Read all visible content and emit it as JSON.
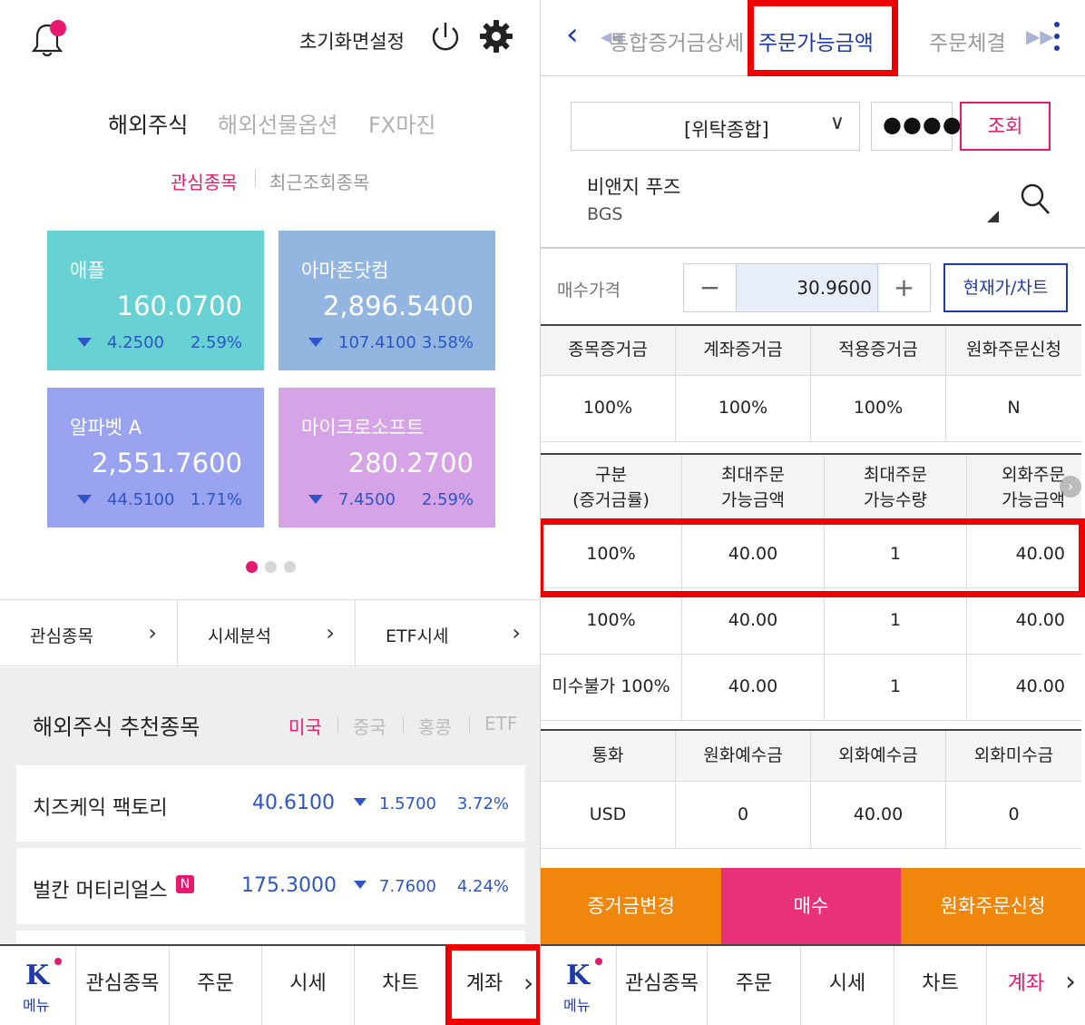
{
  "left": {
    "header": {
      "reset_label": "초기화면설정"
    },
    "market_tabs": [
      "해외주식",
      "해외선물옵션",
      "FX마진"
    ],
    "sub_tabs": [
      "관심종목",
      "최근조회종목"
    ],
    "cards": [
      {
        "name": "애플",
        "price": "160.0700",
        "change": "4.2500",
        "percent": "2.59%",
        "color": "#67d1d3"
      },
      {
        "name": "아마존닷컴",
        "price": "2,896.5400",
        "change": "107.4100",
        "percent": "3.58%",
        "color": "#93b6e1"
      },
      {
        "name": "알파벳 A",
        "price": "2,551.7600",
        "change": "44.5100",
        "percent": "1.71%",
        "color": "#9aa3f0"
      },
      {
        "name": "마이크로소프트",
        "price": "280.2700",
        "change": "7.4500",
        "percent": "2.59%",
        "color": "#d6a3e6"
      }
    ],
    "quick_links": [
      "관심종목",
      "시세분석",
      "ETF시세"
    ],
    "recommend": {
      "title": "해외주식 추천종목",
      "tabs": [
        "미국",
        "중국",
        "홍콩",
        "ETF"
      ],
      "rows": [
        {
          "name": "치즈케익 팩토리",
          "price": "40.6100",
          "change": "1.5700",
          "percent": "3.72%"
        },
        {
          "name": "벌칸 머티리얼스",
          "badge": "N",
          "price": "175.3000",
          "change": "7.7600",
          "percent": "4.24%"
        }
      ]
    },
    "bottom_nav": {
      "menu": "메뉴",
      "items": [
        "관심종목",
        "주문",
        "시세",
        "차트",
        "계좌"
      ]
    }
  },
  "right": {
    "tabs": [
      "통합증거금상세",
      "주문가능금액",
      "주문체결"
    ],
    "account": {
      "type": "[위탁종합]",
      "password": "●●●●",
      "query_button": "조회"
    },
    "stock": {
      "name": "비앤지 푸즈",
      "code": "BGS"
    },
    "buy_price": {
      "label": "매수가격",
      "value": "30.9600",
      "chart_button": "현재가/차트"
    },
    "margin_table": {
      "headers": [
        "종목증거금",
        "계좌증거금",
        "적용증거금",
        "원화주문신청"
      ],
      "values": [
        "100%",
        "100%",
        "100%",
        "N"
      ]
    },
    "order_table": {
      "headers": [
        [
          "구분",
          "(증거금률)"
        ],
        [
          "최대주문",
          "가능금액"
        ],
        [
          "최대주문",
          "가능수량"
        ],
        [
          "외화주문",
          "가능금액"
        ]
      ],
      "rows": [
        [
          "100%",
          "40.00",
          "1",
          "40.00"
        ],
        [
          "100%",
          "40.00",
          "1",
          "40.00"
        ],
        [
          "미수불가 100%",
          "40.00",
          "1",
          "40.00"
        ]
      ]
    },
    "currency_table": {
      "headers": [
        "통화",
        "원화예수금",
        "외화예수금",
        "외화미수금"
      ],
      "values": [
        "USD",
        "0",
        "40.00",
        "0"
      ]
    },
    "actions": [
      {
        "label": "증거금변경",
        "color": "#f0860c"
      },
      {
        "label": "매수",
        "color": "#e9317a"
      },
      {
        "label": "원화주문신청",
        "color": "#f0860c"
      }
    ],
    "bottom_nav": {
      "menu": "메뉴",
      "items": [
        "관심종목",
        "주문",
        "시세",
        "차트",
        "계좌"
      ]
    }
  }
}
